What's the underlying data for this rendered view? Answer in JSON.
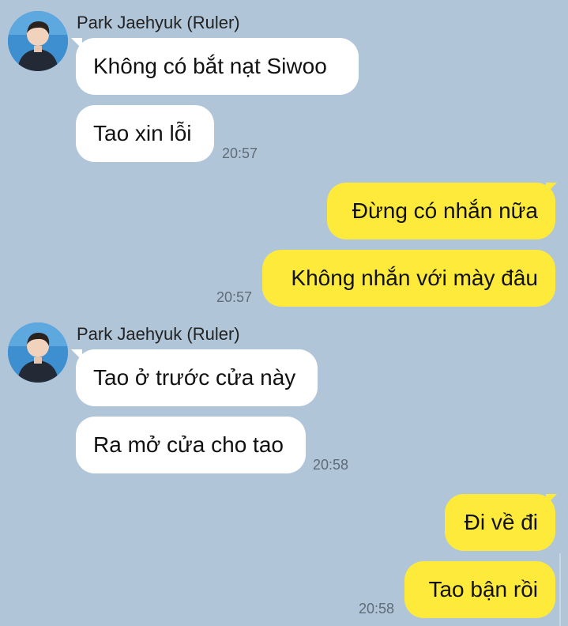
{
  "chat": {
    "groups": [
      {
        "sender": "Park Jaehyuk (Ruler)",
        "messages": [
          "Không có bắt nạt Siwoo",
          "Tao xin lỗi"
        ],
        "time": "20:57"
      },
      {
        "messages": [
          "Đừng có nhắn nữa",
          "Không nhắn với mày đâu"
        ],
        "time": "20:57"
      },
      {
        "sender": "Park Jaehyuk (Ruler)",
        "messages": [
          "Tao ở trước cửa này",
          "Ra mở cửa cho tao"
        ],
        "time": "20:58"
      },
      {
        "messages": [
          "Đi về đi",
          "Tao bận rồi"
        ],
        "time": "20:58"
      }
    ]
  },
  "colors": {
    "background": "#b1c5d9",
    "incoming_bubble": "#ffffff",
    "outgoing_bubble": "#fdea3a",
    "timestamp": "#5f6c78"
  },
  "icons": {
    "avatar": "profile-photo-icon"
  }
}
